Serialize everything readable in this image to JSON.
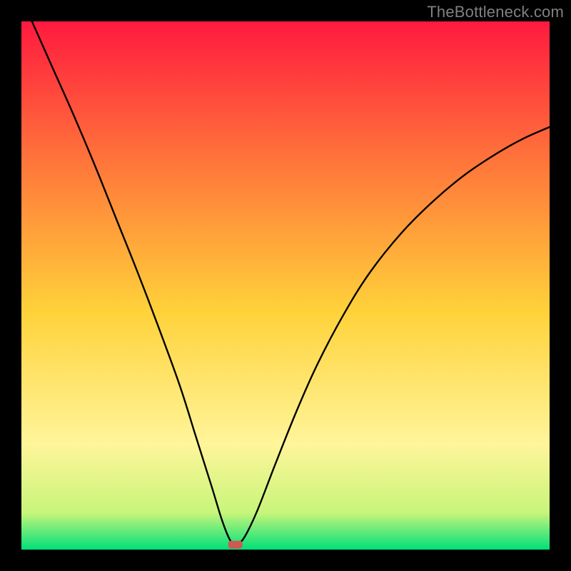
{
  "watermark": "TheBottleneck.com",
  "chart_data": {
    "type": "line",
    "title": "",
    "xlabel": "",
    "ylabel": "",
    "xlim": [
      0,
      1
    ],
    "ylim": [
      0,
      1
    ],
    "gradient_colors": {
      "top": "#ff1a3f",
      "upper_mid": "#ff7a3a",
      "mid": "#ffd23a",
      "lower_mid": "#fff59a",
      "near_bottom": "#c8f57a",
      "bottom": "#00e07a"
    },
    "curve": {
      "description": "V-shaped bottleneck curve with minimum near x≈0.40. Left branch descends steeply from top-left; right branch rises with decreasing slope toward upper-right.",
      "minimum_x": 0.4,
      "minimum_y": 0.01,
      "left_branch": [
        {
          "x": 0.02,
          "y": 1.0
        },
        {
          "x": 0.06,
          "y": 0.91
        },
        {
          "x": 0.1,
          "y": 0.82
        },
        {
          "x": 0.14,
          "y": 0.725
        },
        {
          "x": 0.18,
          "y": 0.625
        },
        {
          "x": 0.22,
          "y": 0.525
        },
        {
          "x": 0.26,
          "y": 0.42
        },
        {
          "x": 0.3,
          "y": 0.31
        },
        {
          "x": 0.33,
          "y": 0.215
        },
        {
          "x": 0.36,
          "y": 0.12
        },
        {
          "x": 0.38,
          "y": 0.055
        },
        {
          "x": 0.395,
          "y": 0.018
        },
        {
          "x": 0.405,
          "y": 0.01
        }
      ],
      "right_branch": [
        {
          "x": 0.405,
          "y": 0.01
        },
        {
          "x": 0.42,
          "y": 0.02
        },
        {
          "x": 0.445,
          "y": 0.07
        },
        {
          "x": 0.48,
          "y": 0.16
        },
        {
          "x": 0.52,
          "y": 0.26
        },
        {
          "x": 0.56,
          "y": 0.35
        },
        {
          "x": 0.61,
          "y": 0.445
        },
        {
          "x": 0.66,
          "y": 0.525
        },
        {
          "x": 0.72,
          "y": 0.6
        },
        {
          "x": 0.78,
          "y": 0.66
        },
        {
          "x": 0.84,
          "y": 0.71
        },
        {
          "x": 0.9,
          "y": 0.75
        },
        {
          "x": 0.95,
          "y": 0.778
        },
        {
          "x": 1.0,
          "y": 0.8
        }
      ]
    },
    "marker": {
      "x": 0.405,
      "y": 0.01,
      "color": "#cc5a50",
      "shape": "rounded-rect"
    }
  }
}
